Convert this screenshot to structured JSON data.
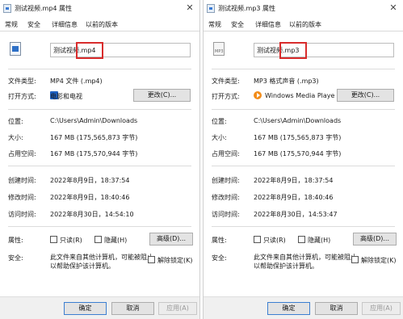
{
  "left": {
    "title": "测试视频.mp4 属性",
    "close": "✕",
    "tabs": [
      "常规",
      "安全",
      "详细信息",
      "以前的版本"
    ],
    "filename_base": "测试视频",
    "filename_ext": ".mp4",
    "rows": {
      "type_label": "文件类型:",
      "type_value": "MP4 文件 (.mp4)",
      "open_label": "打开方式:",
      "open_value": "电影和电视",
      "change_btn": "更改(C)...",
      "location_label": "位置:",
      "location_value": "C:\\Users\\Admin\\Downloads",
      "size_label": "大小:",
      "size_value": "167 MB (175,565,873 字节)",
      "disk_label": "占用空间:",
      "disk_value": "167 MB (175,570,944 字节)",
      "created_label": "创建时间:",
      "created_value": "2022年8月9日，18:37:54",
      "modified_label": "修改时间:",
      "modified_value": "2022年8月9日，18:40:46",
      "accessed_label": "访问时间:",
      "accessed_value": "2022年8月30日，14:54:10",
      "attr_label": "属性:",
      "readonly": "只读(R)",
      "hidden": "隐藏(H)",
      "advanced_btn": "高级(D)...",
      "security_label": "安全:",
      "security_text_1": "此文件来自其他计算机，可能被阻止",
      "security_text_2": "以帮助保护该计算机。",
      "unblock": "解除锁定(K)"
    },
    "footer": {
      "ok": "确定",
      "cancel": "取消",
      "apply": "应用(A)"
    },
    "app_icon": "movies-tv-icon",
    "file_icon": "video-file-icon"
  },
  "right": {
    "title": "测试视频.mp3 属性",
    "close": "✕",
    "tabs": [
      "常规",
      "安全",
      "详细信息",
      "以前的版本"
    ],
    "filename_base": "测试视频",
    "filename_ext": ".mp3",
    "rows": {
      "type_label": "文件类型:",
      "type_value": "MP3 格式声音 (.mp3)",
      "open_label": "打开方式:",
      "open_value": "Windows Media Playe",
      "change_btn": "更改(C)...",
      "location_label": "位置:",
      "location_value": "C:\\Users\\Admin\\Downloads",
      "size_label": "大小:",
      "size_value": "167 MB (175,565,873 字节)",
      "disk_label": "占用空间:",
      "disk_value": "167 MB (175,570,944 字节)",
      "created_label": "创建时间:",
      "created_value": "2022年8月9日，18:37:54",
      "modified_label": "修改时间:",
      "modified_value": "2022年8月9日，18:40:46",
      "accessed_label": "访问时间:",
      "accessed_value": "2022年8月30日，14:53:47",
      "attr_label": "属性:",
      "readonly": "只读(R)",
      "hidden": "隐藏(H)",
      "advanced_btn": "高级(D)...",
      "security_label": "安全:",
      "security_text_1": "此文件来自其他计算机，可能被阻止",
      "security_text_2": "以帮助保护该计算机。",
      "unblock": "解除锁定(K)"
    },
    "footer": {
      "ok": "确定",
      "cancel": "取消",
      "apply": "应用(A)"
    },
    "app_icon": "windows-media-player-icon",
    "file_icon": "audio-file-icon",
    "file_icon_text": "MP3"
  },
  "colors": {
    "highlight": "#d82c2c",
    "accent": "#3c7fd1"
  }
}
